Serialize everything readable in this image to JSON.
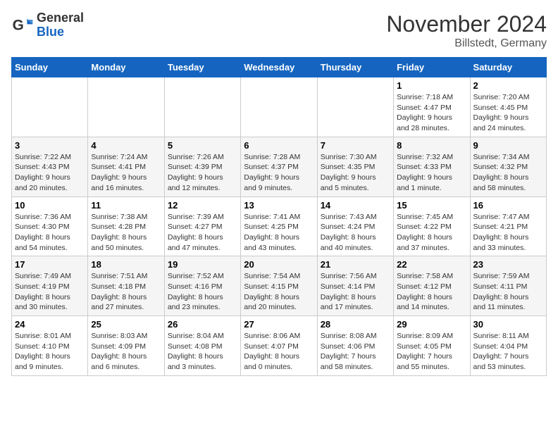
{
  "logo": {
    "general": "General",
    "blue": "Blue"
  },
  "header": {
    "month": "November 2024",
    "location": "Billstedt, Germany"
  },
  "weekdays": [
    "Sunday",
    "Monday",
    "Tuesday",
    "Wednesday",
    "Thursday",
    "Friday",
    "Saturday"
  ],
  "weeks": [
    [
      {
        "day": "",
        "info": ""
      },
      {
        "day": "",
        "info": ""
      },
      {
        "day": "",
        "info": ""
      },
      {
        "day": "",
        "info": ""
      },
      {
        "day": "",
        "info": ""
      },
      {
        "day": "1",
        "info": "Sunrise: 7:18 AM\nSunset: 4:47 PM\nDaylight: 9 hours\nand 28 minutes."
      },
      {
        "day": "2",
        "info": "Sunrise: 7:20 AM\nSunset: 4:45 PM\nDaylight: 9 hours\nand 24 minutes."
      }
    ],
    [
      {
        "day": "3",
        "info": "Sunrise: 7:22 AM\nSunset: 4:43 PM\nDaylight: 9 hours\nand 20 minutes."
      },
      {
        "day": "4",
        "info": "Sunrise: 7:24 AM\nSunset: 4:41 PM\nDaylight: 9 hours\nand 16 minutes."
      },
      {
        "day": "5",
        "info": "Sunrise: 7:26 AM\nSunset: 4:39 PM\nDaylight: 9 hours\nand 12 minutes."
      },
      {
        "day": "6",
        "info": "Sunrise: 7:28 AM\nSunset: 4:37 PM\nDaylight: 9 hours\nand 9 minutes."
      },
      {
        "day": "7",
        "info": "Sunrise: 7:30 AM\nSunset: 4:35 PM\nDaylight: 9 hours\nand 5 minutes."
      },
      {
        "day": "8",
        "info": "Sunrise: 7:32 AM\nSunset: 4:33 PM\nDaylight: 9 hours\nand 1 minute."
      },
      {
        "day": "9",
        "info": "Sunrise: 7:34 AM\nSunset: 4:32 PM\nDaylight: 8 hours\nand 58 minutes."
      }
    ],
    [
      {
        "day": "10",
        "info": "Sunrise: 7:36 AM\nSunset: 4:30 PM\nDaylight: 8 hours\nand 54 minutes."
      },
      {
        "day": "11",
        "info": "Sunrise: 7:38 AM\nSunset: 4:28 PM\nDaylight: 8 hours\nand 50 minutes."
      },
      {
        "day": "12",
        "info": "Sunrise: 7:39 AM\nSunset: 4:27 PM\nDaylight: 8 hours\nand 47 minutes."
      },
      {
        "day": "13",
        "info": "Sunrise: 7:41 AM\nSunset: 4:25 PM\nDaylight: 8 hours\nand 43 minutes."
      },
      {
        "day": "14",
        "info": "Sunrise: 7:43 AM\nSunset: 4:24 PM\nDaylight: 8 hours\nand 40 minutes."
      },
      {
        "day": "15",
        "info": "Sunrise: 7:45 AM\nSunset: 4:22 PM\nDaylight: 8 hours\nand 37 minutes."
      },
      {
        "day": "16",
        "info": "Sunrise: 7:47 AM\nSunset: 4:21 PM\nDaylight: 8 hours\nand 33 minutes."
      }
    ],
    [
      {
        "day": "17",
        "info": "Sunrise: 7:49 AM\nSunset: 4:19 PM\nDaylight: 8 hours\nand 30 minutes."
      },
      {
        "day": "18",
        "info": "Sunrise: 7:51 AM\nSunset: 4:18 PM\nDaylight: 8 hours\nand 27 minutes."
      },
      {
        "day": "19",
        "info": "Sunrise: 7:52 AM\nSunset: 4:16 PM\nDaylight: 8 hours\nand 23 minutes."
      },
      {
        "day": "20",
        "info": "Sunrise: 7:54 AM\nSunset: 4:15 PM\nDaylight: 8 hours\nand 20 minutes."
      },
      {
        "day": "21",
        "info": "Sunrise: 7:56 AM\nSunset: 4:14 PM\nDaylight: 8 hours\nand 17 minutes."
      },
      {
        "day": "22",
        "info": "Sunrise: 7:58 AM\nSunset: 4:12 PM\nDaylight: 8 hours\nand 14 minutes."
      },
      {
        "day": "23",
        "info": "Sunrise: 7:59 AM\nSunset: 4:11 PM\nDaylight: 8 hours\nand 11 minutes."
      }
    ],
    [
      {
        "day": "24",
        "info": "Sunrise: 8:01 AM\nSunset: 4:10 PM\nDaylight: 8 hours\nand 9 minutes."
      },
      {
        "day": "25",
        "info": "Sunrise: 8:03 AM\nSunset: 4:09 PM\nDaylight: 8 hours\nand 6 minutes."
      },
      {
        "day": "26",
        "info": "Sunrise: 8:04 AM\nSunset: 4:08 PM\nDaylight: 8 hours\nand 3 minutes."
      },
      {
        "day": "27",
        "info": "Sunrise: 8:06 AM\nSunset: 4:07 PM\nDaylight: 8 hours\nand 0 minutes."
      },
      {
        "day": "28",
        "info": "Sunrise: 8:08 AM\nSunset: 4:06 PM\nDaylight: 7 hours\nand 58 minutes."
      },
      {
        "day": "29",
        "info": "Sunrise: 8:09 AM\nSunset: 4:05 PM\nDaylight: 7 hours\nand 55 minutes."
      },
      {
        "day": "30",
        "info": "Sunrise: 8:11 AM\nSunset: 4:04 PM\nDaylight: 7 hours\nand 53 minutes."
      }
    ]
  ]
}
